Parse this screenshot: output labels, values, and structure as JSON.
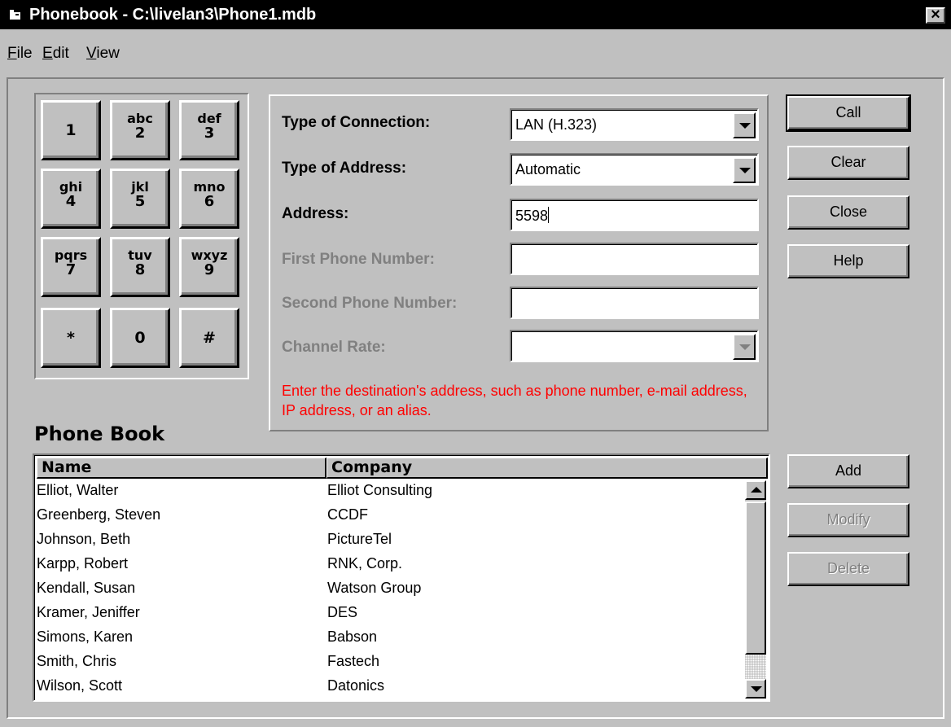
{
  "window": {
    "title": "Phonebook - C:\\livelan3\\Phone1.mdb",
    "close_label": "×"
  },
  "menu": [
    "File",
    "Edit",
    "View"
  ],
  "keypad": [
    {
      "letters": "",
      "digit": "1"
    },
    {
      "letters": "abc",
      "digit": "2"
    },
    {
      "letters": "def",
      "digit": "3"
    },
    {
      "letters": "ghi",
      "digit": "4"
    },
    {
      "letters": "jkl",
      "digit": "5"
    },
    {
      "letters": "mno",
      "digit": "6"
    },
    {
      "letters": "pqrs",
      "digit": "7"
    },
    {
      "letters": "tuv",
      "digit": "8"
    },
    {
      "letters": "wxyz",
      "digit": "9"
    },
    {
      "letters": "",
      "digit": "*"
    },
    {
      "letters": "",
      "digit": "0"
    },
    {
      "letters": "",
      "digit": "#"
    }
  ],
  "connection": {
    "type_of_connection": {
      "label": "Type of Connection:",
      "value": "LAN (H.323)"
    },
    "type_of_address": {
      "label": "Type of Address:",
      "value": "Automatic"
    },
    "address": {
      "label": "Address:",
      "value": "5598"
    },
    "first_phone": {
      "label": "First Phone Number:",
      "value": ""
    },
    "second_phone": {
      "label": "Second Phone Number:",
      "value": ""
    },
    "channel_rate": {
      "label": "Channel Rate:",
      "value": ""
    },
    "hint": "Enter the destination's address, such as phone number, e-mail address, IP address, or an alias."
  },
  "buttons": {
    "call": "Call",
    "clear": "Clear",
    "close": "Close",
    "help": "Help",
    "add": "Add",
    "modify": "Modify",
    "delete": "Delete"
  },
  "phonebook": {
    "title": "Phone Book",
    "columns": [
      "Name",
      "Company"
    ],
    "rows": [
      [
        "Elliot, Walter",
        "Elliot Consulting"
      ],
      [
        "Greenberg, Steven",
        "CCDF"
      ],
      [
        "Johnson, Beth",
        "PictureTel"
      ],
      [
        "Karpp, Robert",
        "RNK, Corp."
      ],
      [
        "Kendall, Susan",
        "Watson Group"
      ],
      [
        "Kramer, Jeniffer",
        "DES"
      ],
      [
        "Simons, Karen",
        "Babson"
      ],
      [
        "Smith, Chris",
        "Fastech"
      ],
      [
        "Wilson, Scott",
        "Datonics"
      ]
    ]
  },
  "colors": {
    "face": "#c0c0c0",
    "titlebar": "#000000",
    "hint_text": "#ff0000",
    "disabled_text": "#808080"
  }
}
